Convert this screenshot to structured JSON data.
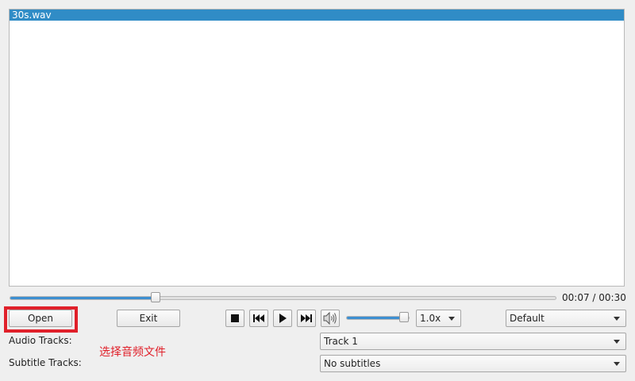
{
  "playlist": {
    "items": [
      {
        "label": "30s.wav",
        "selected": true
      }
    ]
  },
  "seek": {
    "position_fraction": 0.2667,
    "time_label": "00:07 / 00:30"
  },
  "buttons": {
    "open_label": "Open",
    "exit_label": "Exit"
  },
  "transport": {
    "stop_icon": "stop-icon",
    "prev_icon": "skip-back-icon",
    "play_icon": "play-icon",
    "next_icon": "skip-forward-icon",
    "volume_icon": "speaker-icon"
  },
  "volume": {
    "level_fraction": 0.92
  },
  "speed": {
    "selected": "1.0x"
  },
  "output": {
    "selected": "Default"
  },
  "tracks": {
    "audio_label": "Audio Tracks:",
    "audio_selected": "Track 1",
    "subtitle_label": "Subtitle Tracks:",
    "subtitle_selected": "No subtitles"
  },
  "annotation": {
    "text": "选择音频文件",
    "color": "#e0202a"
  },
  "colors": {
    "selection": "#308cc6",
    "slider_fill": "#3d8fd1",
    "highlight": "#e0202a"
  }
}
